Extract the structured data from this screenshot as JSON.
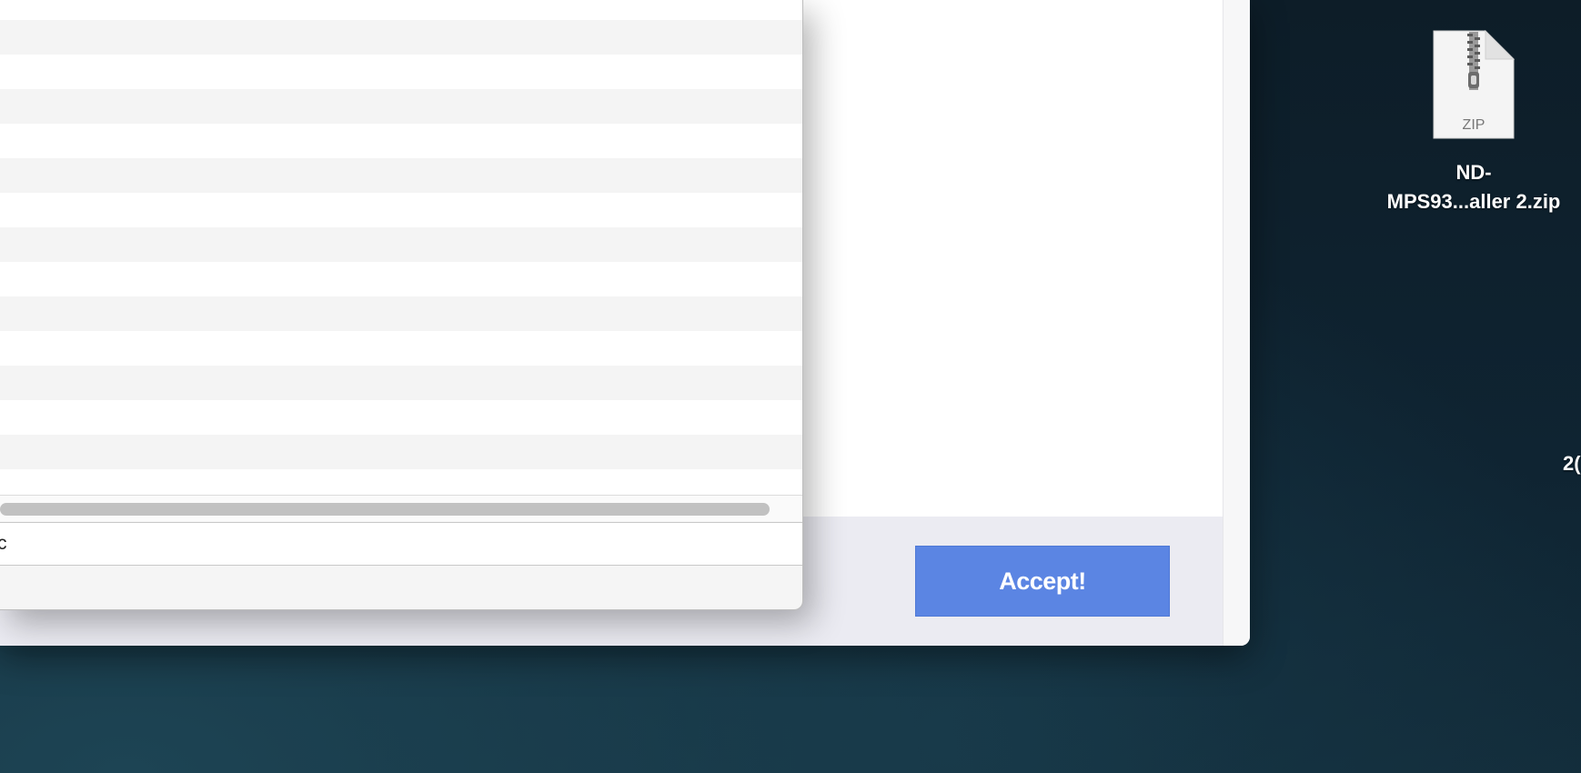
{
  "page": {
    "accept_label": "Accept!",
    "accept_color": "#5b85e3"
  },
  "dialog": {
    "path_field_value": "c",
    "row_count": 14
  },
  "desktop": {
    "zip_file": {
      "icon": "zip-file-icon",
      "icon_text": "ZIP",
      "label_line1": "ND-",
      "label_line2": "MPS93...aller 2.zip"
    },
    "partial_item_label": "2("
  }
}
